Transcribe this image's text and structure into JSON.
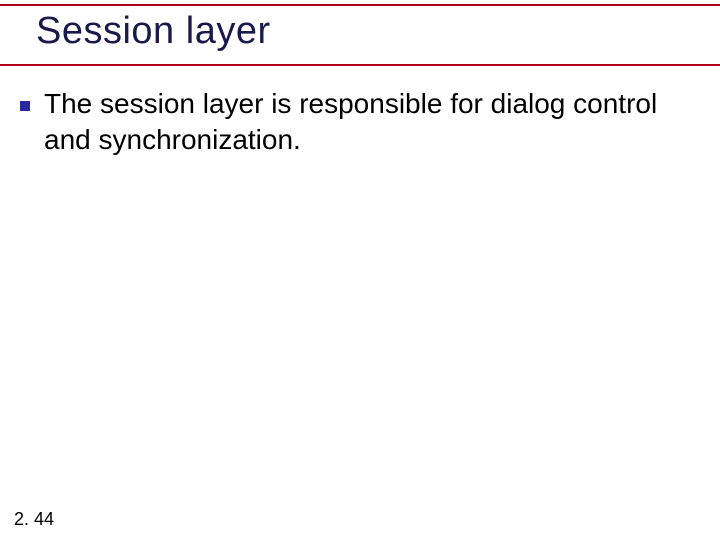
{
  "title": "Session layer",
  "bullets": [
    {
      "text": "The session layer is responsible for dialog control and synchronization."
    }
  ],
  "slide_number": "2. 44",
  "colors": {
    "rule": "#b00020",
    "title": "#1a1a4a",
    "bullet_square": "#2a2aa0"
  }
}
